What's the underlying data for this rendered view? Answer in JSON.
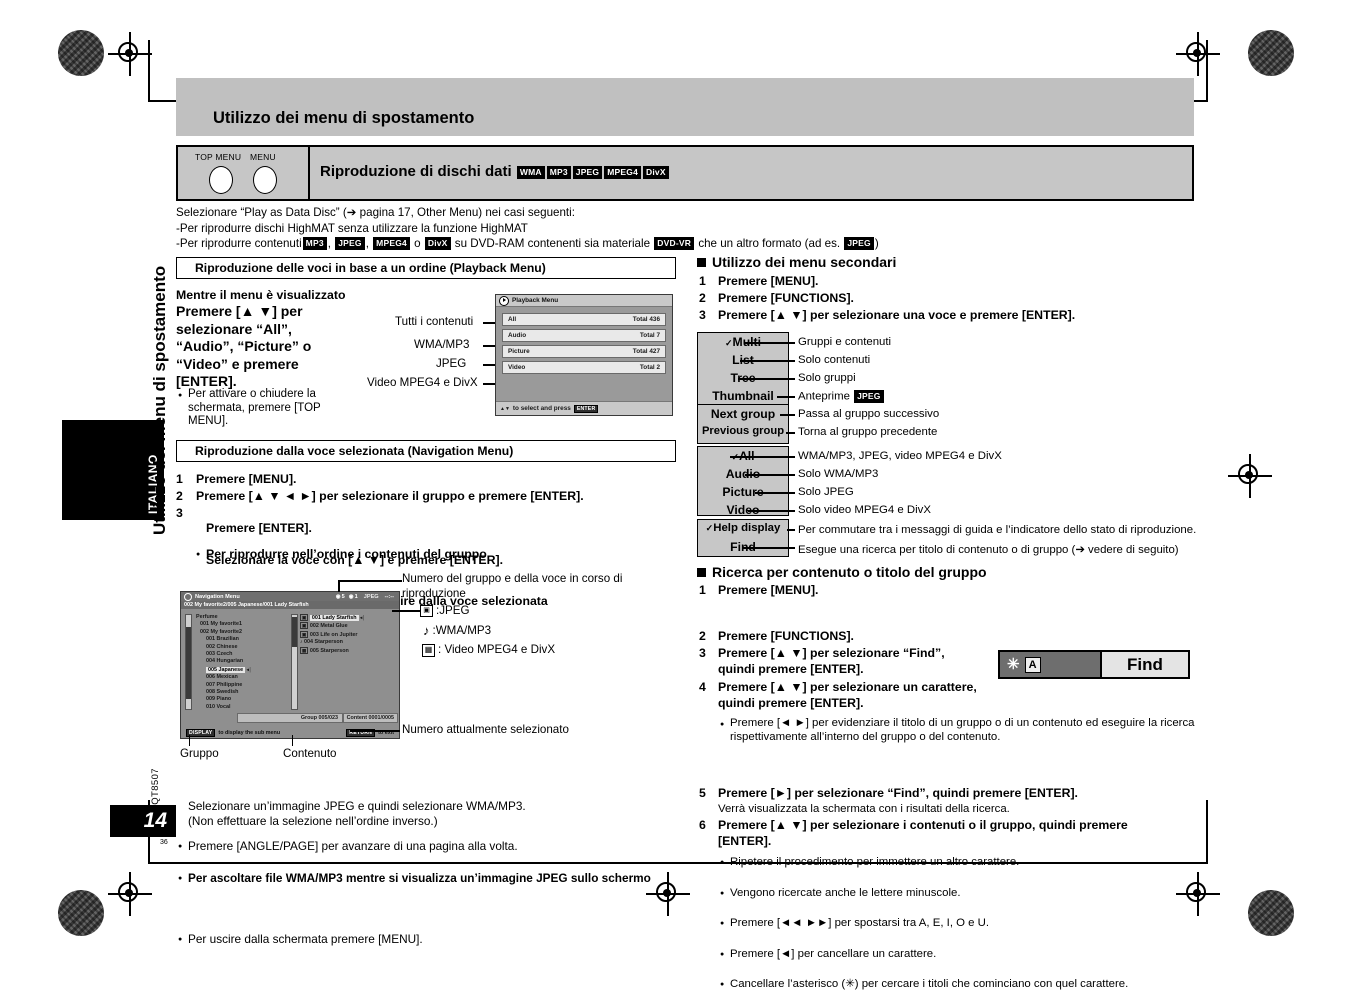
{
  "page": {
    "header_title": "Utilizzo dei menu di spostamento",
    "section_title": "Riproduzione di dischi dati",
    "section_chips": [
      "WMA",
      "MP3",
      "JPEG",
      "MPEG4",
      "DivX"
    ],
    "button_labels": [
      "TOP MENU",
      "MENU"
    ],
    "language_tab": "ITALIANO",
    "side_title": "Utilizzo dei menu di spostamento",
    "side_code": "RQT8507",
    "page_number": "14",
    "page_sub": "36"
  },
  "intro": {
    "line1": "Selezionare “Play as Data Disc” (➔ pagina 17, Other Menu) nei casi seguenti:",
    "line2": "-Per riprodurre dischi HighMAT senza utilizzare la funzione HighMAT",
    "line3_a": "-Per riprodurre contenuti",
    "line3_chip1": "MP3",
    "line3_b": ",",
    "line3_chip2": "JPEG",
    "line3_c": ",",
    "line3_chip3": "MPEG4",
    "line3_d": "o",
    "line3_chip4": "DivX",
    "line3_e": "su DVD-RAM contenenti sia materiale",
    "line3_chip5": "DVD-VR",
    "line3_f": "che un altro formato (ad es.",
    "line3_chip6": "JPEG",
    "line3_g": ")"
  },
  "playback": {
    "box_title": "Riproduzione delle voci in base a un ordine (Playback Menu)",
    "lead": "Mentre il menu è visualizzato",
    "instruction": "Premere [▲ ▼] per selezionare “All”, “Audio”, “Picture” o “Video” e premere [ENTER].",
    "bullet": "Per attivare o chiudere la schermata, premere [TOP MENU].",
    "callouts": [
      "Tutti i contenuti",
      "WMA/MP3",
      "JPEG",
      "Video MPEG4 e DivX"
    ],
    "screen": {
      "title": "Playback Menu",
      "rows": [
        {
          "label": "All",
          "total": "Total 436"
        },
        {
          "label": "Audio",
          "total": "Total 7"
        },
        {
          "label": "Picture",
          "total": "Total 427"
        },
        {
          "label": "Video",
          "total": "Total 2"
        }
      ],
      "footer": "to select and press",
      "footer_key": "ENTER"
    }
  },
  "navigation": {
    "box_title": "Riproduzione dalla voce selezionata (Navigation Menu)",
    "steps": [
      {
        "num": "1",
        "text": "Premere [MENU]."
      },
      {
        "num": "2",
        "text": "Premere [▲ ▼ ◄ ►] per selezionare il gruppo e premere [ENTER]."
      },
      {
        "num": "3",
        "text": ""
      }
    ],
    "step3_a": "Per riprodurre nell’ordine i contenuti del gruppo",
    "step3_a2": "Premere [ENTER].",
    "step3_b": "Per avviare la riproduzione a partire dalla voce selezionata",
    "step3_b2": "Selezionare la voce con [▲ ▼] e premere [ENTER].",
    "screen": {
      "title": "Navigation Menu",
      "badge1": "5",
      "badge2": "1",
      "format": "JPEG",
      "time": "--:--",
      "path": "002 My favorite2/005 Japanese/001 Lady Starfish",
      "tree": [
        "Perfume",
        "001 My favorite1",
        "002 My favorite2",
        "001 Brazilian",
        "002 Chinese",
        "003 Czech",
        "004 Hungarian",
        "005 Japanese",
        "006 Mexican",
        "007 Philippine",
        "008 Swedish",
        "009 Piano",
        "010 Vocal"
      ],
      "tree_selected": "005 Japanese",
      "contents": [
        "001 Lady Starfish",
        "002 Metal Glue",
        "003 Life on Jupiter",
        "004 Starperson",
        "005 Starperson"
      ],
      "contents_selected": "001 Lady Starfish",
      "group_status": "Group  005/023",
      "content_status": "Content  0001/0005",
      "hint_left_key": "DISPLAY",
      "hint_left": "to display the sub menu",
      "hint_right_key": "RETURN",
      "hint_right": "to exit"
    },
    "callout_group": "Gruppo",
    "callout_content": "Contenuto",
    "callout_number": "Numero del gruppo e della voce in corso di riproduzione",
    "callout_selected": "Numero attualmente selezionato",
    "legend": [
      {
        "icon": "jpeg-icon",
        "text": ":JPEG"
      },
      {
        "icon": "music-note-icon",
        "text": ":WMA/MP3"
      },
      {
        "icon": "film-strip-icon",
        "text": ": Video MPEG4 e DivX"
      }
    ],
    "notes": [
      {
        "bold": false,
        "text": "Premere [ANGLE/PAGE] per avanzare di una pagina alla volta."
      },
      {
        "bold": true,
        "text": "Per ascoltare file WMA/MP3 mentre si visualizza un’immagine JPEG sullo schermo"
      },
      {
        "bold": false,
        "text": "Selezionare un’immagine JPEG e quindi selezionare WMA/MP3."
      },
      {
        "bold": false,
        "text": "(Non effettuare la selezione nell’ordine inverso.)"
      },
      {
        "bold": false,
        "text": "Per uscire dalla schermata premere [MENU]."
      }
    ]
  },
  "submenu": {
    "heading": "Utilizzo dei menu secondari",
    "steps": [
      {
        "num": "1",
        "text": "Premere [MENU]."
      },
      {
        "num": "2",
        "text": "Premere [FUNCTIONS]."
      },
      {
        "num": "3",
        "text": "Premere [▲ ▼] per selezionare una voce e premere [ENTER]."
      }
    ],
    "group1": [
      {
        "check": true,
        "label": "Multi",
        "desc": "Gruppi e contenuti"
      },
      {
        "check": false,
        "label": "List",
        "desc": "Solo contenuti"
      },
      {
        "check": false,
        "label": "Tree",
        "desc": "Solo gruppi"
      },
      {
        "check": false,
        "label": "Thumbnail",
        "desc": "Anteprime",
        "chip": "JPEG"
      },
      {
        "check": false,
        "label": "Next group",
        "desc": "Passa al gruppo successivo"
      },
      {
        "check": false,
        "label": "Previous group",
        "desc": "Torna al gruppo precedente"
      }
    ],
    "group2": [
      {
        "check": true,
        "label": "All",
        "desc": "WMA/MP3, JPEG, video MPEG4 e DivX"
      },
      {
        "check": false,
        "label": "Audio",
        "desc": "Solo WMA/MP3"
      },
      {
        "check": false,
        "label": "Picture",
        "desc": "Solo JPEG"
      },
      {
        "check": false,
        "label": "Video",
        "desc": "Solo video MPEG4 e DivX"
      }
    ],
    "group3": [
      {
        "check": true,
        "label": "Help display",
        "desc": "Per commutare tra i messaggi di guida e l’indicatore dello stato di riproduzione."
      },
      {
        "check": false,
        "label": "Find",
        "desc": "Esegue una ricerca per titolo di contenuto o di gruppo (➔ vedere di seguito)"
      }
    ]
  },
  "find": {
    "heading": "Ricerca per contenuto o titolo del gruppo",
    "step1_num": "1",
    "step1": "Premere [MENU].",
    "step1_note": "Premere [◄ ►] per evidenziare il titolo di un gruppo o di un contenuto ed eseguire la ricerca rispettivamente all’interno del gruppo o del contenuto.",
    "step2_num": "2",
    "step2": "Premere [FUNCTIONS].",
    "step3_num": "3",
    "step3": "Premere [▲ ▼] per selezionare “Find”, quindi premere [ENTER].",
    "step4_num": "4",
    "step4": "Premere [▲ ▼] per selezionare un carattere, quindi premere [ENTER].",
    "step4_notes": [
      "Ripetere il procedimento per immettere un altro carattere.",
      "Vengono ricercate anche le lettere minuscole.",
      "Premere [◄◄ ►►] per spostarsi tra A, E, I, O e U.",
      "Premere [◄] per cancellare un carattere.",
      "Cancellare l’asterisco (✳) per cercare i titoli che cominciano con quel carattere."
    ],
    "step5_num": "5",
    "step5": "Premere [►] per selezionare “Find”, quindi premere [ENTER].",
    "step5_note": "Verrà visualizzata la schermata con i risultati della ricerca.",
    "step6_num": "6",
    "step6": "Premere [▲ ▼] per selezionare i contenuti o il gruppo, quindi premere [ENTER].",
    "bar": {
      "asterisk": "✳",
      "char": "A",
      "button": "Find"
    }
  }
}
